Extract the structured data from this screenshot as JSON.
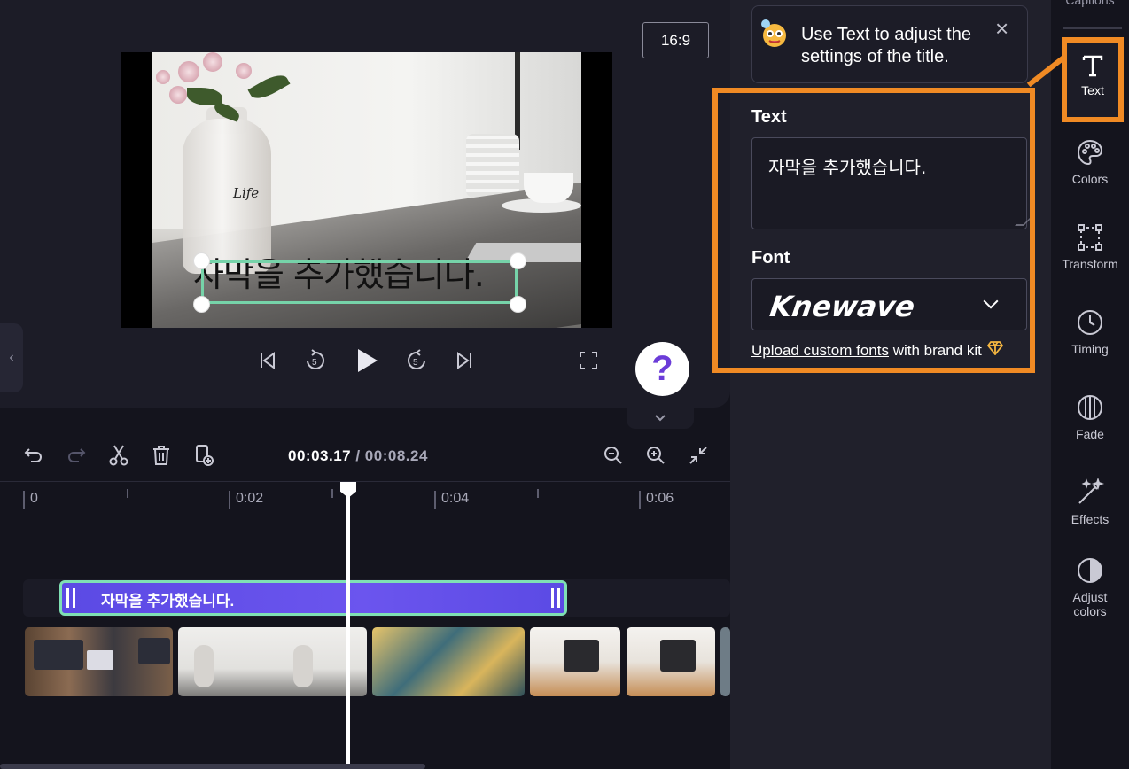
{
  "preview": {
    "aspect_ratio": "16:9",
    "photo_vase_text": "Life",
    "caption_overlay": "자막을 추가했습니다.",
    "help_label": "?"
  },
  "timeline": {
    "current_time": "00:03.17",
    "separator": " / ",
    "total_time": "00:08.24",
    "ruler_labels": [
      "0",
      "0:02",
      "0:04",
      "0:06"
    ],
    "caption_clip_label": "자막을 추가했습니다."
  },
  "tooltip": {
    "text": "Use Text to adjust the settings of the title.",
    "close_label": "×"
  },
  "text_panel": {
    "text_label": "Text",
    "text_value": "자막을 추가했습니다.",
    "font_label": "Font",
    "font_value": "Knewave",
    "upload_link": "Upload custom fonts",
    "upload_suffix": " with brand kit"
  },
  "right_toolbar": {
    "captions_label": "Captions",
    "items": [
      {
        "label": "Text",
        "icon": "text-icon",
        "active": true
      },
      {
        "label": "Colors",
        "icon": "palette-icon"
      },
      {
        "label": "Transform",
        "icon": "transform-icon"
      },
      {
        "label": "Timing",
        "icon": "clock-icon"
      },
      {
        "label": "Fade",
        "icon": "fade-icon"
      },
      {
        "label": "Effects",
        "icon": "magic-wand-icon"
      },
      {
        "label": "Adjust colors",
        "icon": "adjust-colors-icon"
      }
    ]
  },
  "colors": {
    "highlight": "#f08a24",
    "selection": "#76d3a9",
    "caption_clip": "#5b4ae4"
  }
}
